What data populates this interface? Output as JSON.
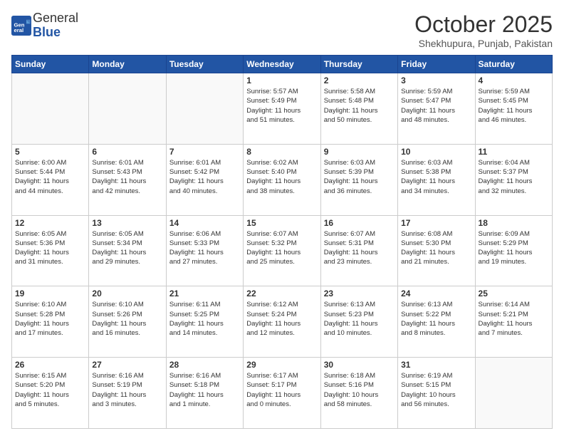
{
  "logo": {
    "general": "General",
    "blue": "Blue"
  },
  "title": "October 2025",
  "location": "Shekhupura, Punjab, Pakistan",
  "days_of_week": [
    "Sunday",
    "Monday",
    "Tuesday",
    "Wednesday",
    "Thursday",
    "Friday",
    "Saturday"
  ],
  "weeks": [
    [
      {
        "day": "",
        "info": ""
      },
      {
        "day": "",
        "info": ""
      },
      {
        "day": "",
        "info": ""
      },
      {
        "day": "1",
        "info": "Sunrise: 5:57 AM\nSunset: 5:49 PM\nDaylight: 11 hours\nand 51 minutes."
      },
      {
        "day": "2",
        "info": "Sunrise: 5:58 AM\nSunset: 5:48 PM\nDaylight: 11 hours\nand 50 minutes."
      },
      {
        "day": "3",
        "info": "Sunrise: 5:59 AM\nSunset: 5:47 PM\nDaylight: 11 hours\nand 48 minutes."
      },
      {
        "day": "4",
        "info": "Sunrise: 5:59 AM\nSunset: 5:45 PM\nDaylight: 11 hours\nand 46 minutes."
      }
    ],
    [
      {
        "day": "5",
        "info": "Sunrise: 6:00 AM\nSunset: 5:44 PM\nDaylight: 11 hours\nand 44 minutes."
      },
      {
        "day": "6",
        "info": "Sunrise: 6:01 AM\nSunset: 5:43 PM\nDaylight: 11 hours\nand 42 minutes."
      },
      {
        "day": "7",
        "info": "Sunrise: 6:01 AM\nSunset: 5:42 PM\nDaylight: 11 hours\nand 40 minutes."
      },
      {
        "day": "8",
        "info": "Sunrise: 6:02 AM\nSunset: 5:40 PM\nDaylight: 11 hours\nand 38 minutes."
      },
      {
        "day": "9",
        "info": "Sunrise: 6:03 AM\nSunset: 5:39 PM\nDaylight: 11 hours\nand 36 minutes."
      },
      {
        "day": "10",
        "info": "Sunrise: 6:03 AM\nSunset: 5:38 PM\nDaylight: 11 hours\nand 34 minutes."
      },
      {
        "day": "11",
        "info": "Sunrise: 6:04 AM\nSunset: 5:37 PM\nDaylight: 11 hours\nand 32 minutes."
      }
    ],
    [
      {
        "day": "12",
        "info": "Sunrise: 6:05 AM\nSunset: 5:36 PM\nDaylight: 11 hours\nand 31 minutes."
      },
      {
        "day": "13",
        "info": "Sunrise: 6:05 AM\nSunset: 5:34 PM\nDaylight: 11 hours\nand 29 minutes."
      },
      {
        "day": "14",
        "info": "Sunrise: 6:06 AM\nSunset: 5:33 PM\nDaylight: 11 hours\nand 27 minutes."
      },
      {
        "day": "15",
        "info": "Sunrise: 6:07 AM\nSunset: 5:32 PM\nDaylight: 11 hours\nand 25 minutes."
      },
      {
        "day": "16",
        "info": "Sunrise: 6:07 AM\nSunset: 5:31 PM\nDaylight: 11 hours\nand 23 minutes."
      },
      {
        "day": "17",
        "info": "Sunrise: 6:08 AM\nSunset: 5:30 PM\nDaylight: 11 hours\nand 21 minutes."
      },
      {
        "day": "18",
        "info": "Sunrise: 6:09 AM\nSunset: 5:29 PM\nDaylight: 11 hours\nand 19 minutes."
      }
    ],
    [
      {
        "day": "19",
        "info": "Sunrise: 6:10 AM\nSunset: 5:28 PM\nDaylight: 11 hours\nand 17 minutes."
      },
      {
        "day": "20",
        "info": "Sunrise: 6:10 AM\nSunset: 5:26 PM\nDaylight: 11 hours\nand 16 minutes."
      },
      {
        "day": "21",
        "info": "Sunrise: 6:11 AM\nSunset: 5:25 PM\nDaylight: 11 hours\nand 14 minutes."
      },
      {
        "day": "22",
        "info": "Sunrise: 6:12 AM\nSunset: 5:24 PM\nDaylight: 11 hours\nand 12 minutes."
      },
      {
        "day": "23",
        "info": "Sunrise: 6:13 AM\nSunset: 5:23 PM\nDaylight: 11 hours\nand 10 minutes."
      },
      {
        "day": "24",
        "info": "Sunrise: 6:13 AM\nSunset: 5:22 PM\nDaylight: 11 hours\nand 8 minutes."
      },
      {
        "day": "25",
        "info": "Sunrise: 6:14 AM\nSunset: 5:21 PM\nDaylight: 11 hours\nand 7 minutes."
      }
    ],
    [
      {
        "day": "26",
        "info": "Sunrise: 6:15 AM\nSunset: 5:20 PM\nDaylight: 11 hours\nand 5 minutes."
      },
      {
        "day": "27",
        "info": "Sunrise: 6:16 AM\nSunset: 5:19 PM\nDaylight: 11 hours\nand 3 minutes."
      },
      {
        "day": "28",
        "info": "Sunrise: 6:16 AM\nSunset: 5:18 PM\nDaylight: 11 hours\nand 1 minute."
      },
      {
        "day": "29",
        "info": "Sunrise: 6:17 AM\nSunset: 5:17 PM\nDaylight: 11 hours\nand 0 minutes."
      },
      {
        "day": "30",
        "info": "Sunrise: 6:18 AM\nSunset: 5:16 PM\nDaylight: 10 hours\nand 58 minutes."
      },
      {
        "day": "31",
        "info": "Sunrise: 6:19 AM\nSunset: 5:15 PM\nDaylight: 10 hours\nand 56 minutes."
      },
      {
        "day": "",
        "info": ""
      }
    ]
  ]
}
